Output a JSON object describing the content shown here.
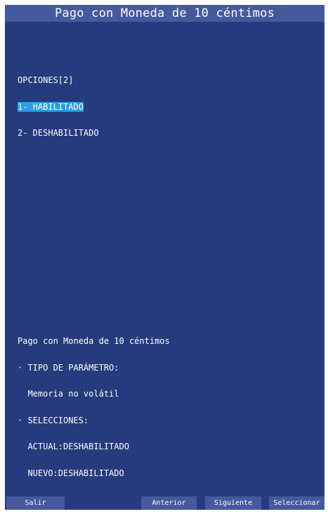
{
  "title": "Pago con Moneda de 10 céntimos",
  "options": {
    "header": "OPCIONES[2]",
    "items": [
      {
        "label": "1- HABILITADO",
        "selected": true
      },
      {
        "label": "2- DESHABILITADO",
        "selected": false
      }
    ]
  },
  "info": {
    "heading": "Pago con Moneda de 10 céntimos",
    "param_type_label": "· TIPO DE PARÁMETRO:",
    "param_type_value": "  Memoria no volátil",
    "selections_label": "· SELECCIONES:",
    "current": "  ACTUAL:DESHABILITADO",
    "new": "  NUEVO:DESHABILITADO"
  },
  "footer": {
    "exit": "Salir",
    "previous": "Anterior",
    "next": "Siguiente",
    "select": "Seleccionar"
  },
  "colors": {
    "background": "#263a7e",
    "bar": "#445a9c",
    "highlight": "#2f9be0",
    "text": "#ffffff"
  }
}
